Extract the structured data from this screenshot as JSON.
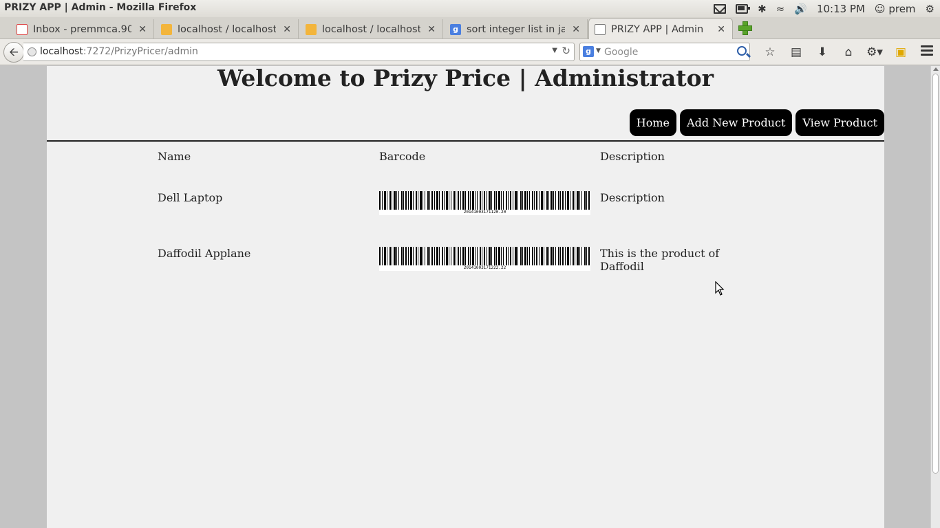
{
  "window": {
    "title": "PRIZY APP | Admin - Mozilla Firefox"
  },
  "tray": {
    "time": "10:13 PM",
    "user": "prem"
  },
  "tabs": [
    {
      "label": "Inbox - premmca.90…",
      "icon": "gmail-icon"
    },
    {
      "label": "localhost / localhost…",
      "icon": "phpmyadmin-icon"
    },
    {
      "label": "localhost / localhost…",
      "icon": "phpmyadmin-icon"
    },
    {
      "label": "sort integer list in ja…",
      "icon": "google-icon"
    },
    {
      "label": "PRIZY APP | Admin",
      "icon": "page-icon",
      "active": true
    }
  ],
  "url": {
    "host": "localhost",
    "path": ":7272/PrizyPricer/admin"
  },
  "search": {
    "placeholder": "Google"
  },
  "page": {
    "heading": "Welcome to Prizy Price | Administrator",
    "nav": {
      "home": "Home",
      "add": "Add New Product",
      "view": "View Product"
    },
    "table": {
      "headers": {
        "name": "Name",
        "barcode": "Barcode",
        "description": "Description"
      },
      "rows": [
        {
          "name": "Dell Laptop",
          "barcode": "20141003171120.20",
          "description": "Description"
        },
        {
          "name": "Daffodil Applane",
          "barcode": "20141003171222.22",
          "description": "This is the product of Daffodil"
        }
      ]
    }
  },
  "colors": {
    "nav_button_bg": "#000000",
    "page_bg": "#f0f0f0"
  }
}
